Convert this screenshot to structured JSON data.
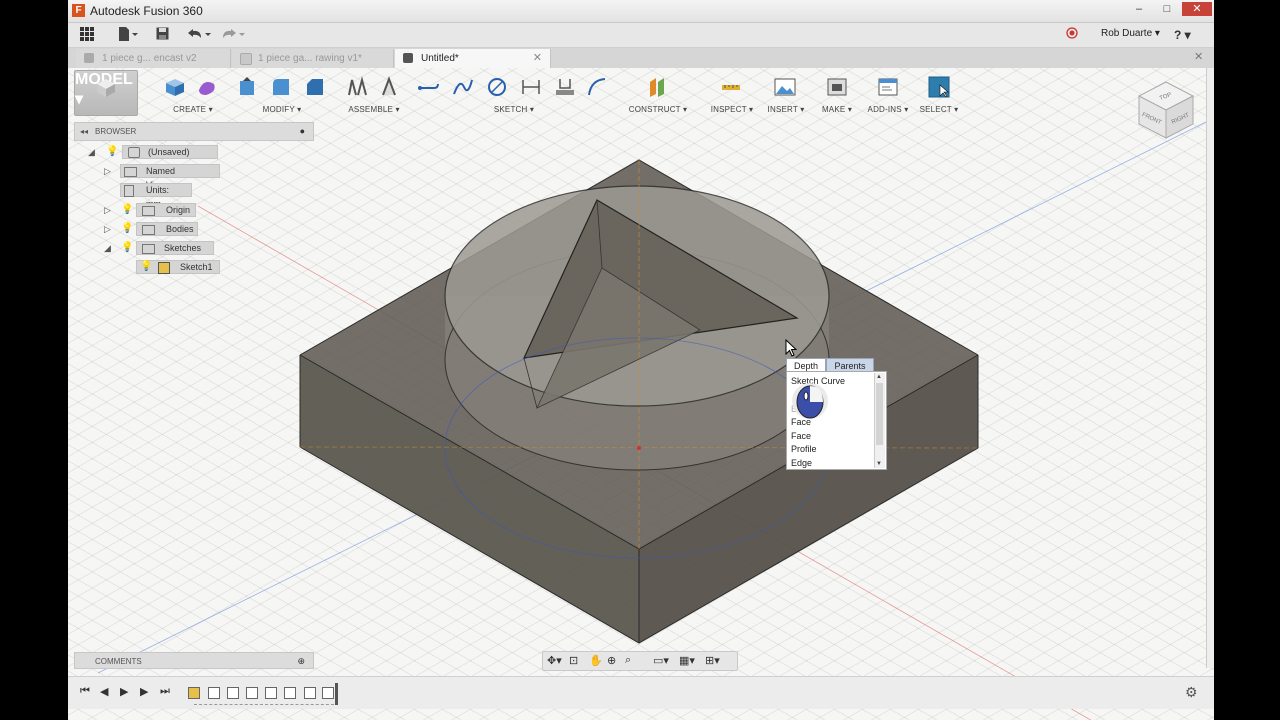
{
  "window": {
    "title": "Autodesk Fusion 360",
    "logo": "F",
    "controls": [
      "–",
      "□",
      "✕"
    ]
  },
  "appbar": {
    "user": "Rob Duarte ▾",
    "help": "? ▾"
  },
  "tabs": [
    {
      "label": "1 piece g... encast v2",
      "active": false
    },
    {
      "label": "1 piece ga... rawing v1*",
      "active": false
    },
    {
      "label": "Untitled*",
      "active": true
    }
  ],
  "toolbar": {
    "groups": [
      {
        "id": "model",
        "label": "MODEL ▾"
      },
      {
        "id": "create",
        "label": "CREATE ▾"
      },
      {
        "id": "modify",
        "label": "MODIFY ▾"
      },
      {
        "id": "assemble",
        "label": "ASSEMBLE ▾"
      },
      {
        "id": "sketch",
        "label": "SKETCH ▾"
      },
      {
        "id": "construct",
        "label": "CONSTRUCT ▾"
      },
      {
        "id": "inspect",
        "label": "INSPECT ▾"
      },
      {
        "id": "insert",
        "label": "INSERT ▾"
      },
      {
        "id": "make",
        "label": "MAKE ▾"
      },
      {
        "id": "addins",
        "label": "ADD-INS ▾"
      },
      {
        "id": "select",
        "label": "SELECT ▾"
      }
    ]
  },
  "browser": {
    "title": "BROWSER",
    "nodes": [
      {
        "label": "(Unsaved)"
      },
      {
        "label": "Named Views"
      },
      {
        "label": "Units: mm"
      },
      {
        "label": "Origin"
      },
      {
        "label": "Bodies"
      },
      {
        "label": "Sketches"
      },
      {
        "label": "Sketch1"
      }
    ]
  },
  "comments": {
    "title": "COMMENTS"
  },
  "viewcube": {
    "top": "TOP",
    "front": "FRONT",
    "right": "RIGHT"
  },
  "popup": {
    "tabs": [
      "Depth",
      "Parents"
    ],
    "items": [
      "Sketch Curve",
      "Edge",
      "Face",
      "Face",
      "Profile",
      "Edge"
    ]
  },
  "colors": {
    "accent": "#3a78c2",
    "body": "#5f5a50",
    "viewport_bg": "#f6f7f4"
  }
}
